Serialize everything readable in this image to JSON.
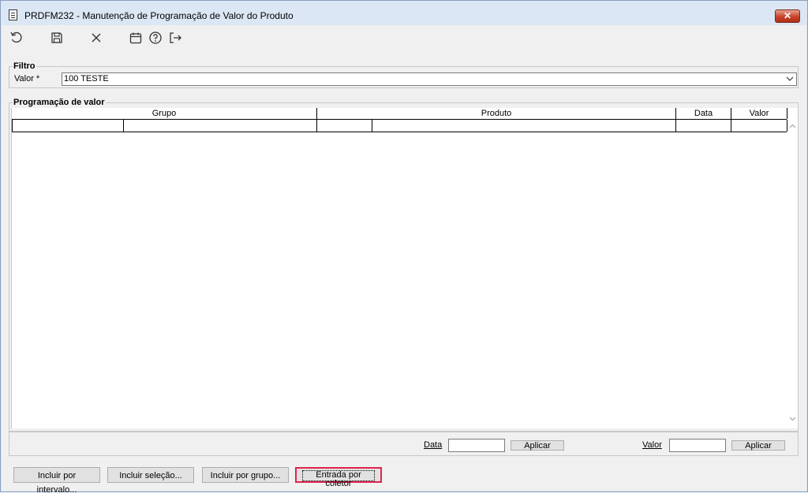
{
  "window": {
    "title": "PRDFM232 - Manutenção de Programação de Valor do Produto",
    "close_label": "✕"
  },
  "toolbar": {
    "icons": [
      "undo-icon",
      "save-icon",
      "cancel-icon",
      "calendar-icon",
      "help-icon",
      "exit-icon"
    ]
  },
  "filtro": {
    "group_label": "Filtro",
    "valor_label": "Valor *",
    "valor_value": "100 TESTE"
  },
  "programacao": {
    "group_label": "Programação de valor",
    "columns": [
      "Grupo",
      "Produto",
      "Data",
      "Valor"
    ]
  },
  "footer": {
    "data_label": "Data",
    "data_value": "",
    "aplicar_label": "Aplicar",
    "valor_label": "Valor",
    "valor_value": "",
    "aplicar2_label": "Aplicar"
  },
  "actions": {
    "incluir_intervalo": "Incluir por intervalo...",
    "incluir_selecao": "Incluir seleção...",
    "incluir_grupo": "Incluir por grupo...",
    "entrada_coletor": "Entrada por coletor"
  },
  "colors": {
    "titlebar": "#dce7f5",
    "panel": "#f0f0f0",
    "close": "#c7432a",
    "focus_border": "#e0244f"
  }
}
